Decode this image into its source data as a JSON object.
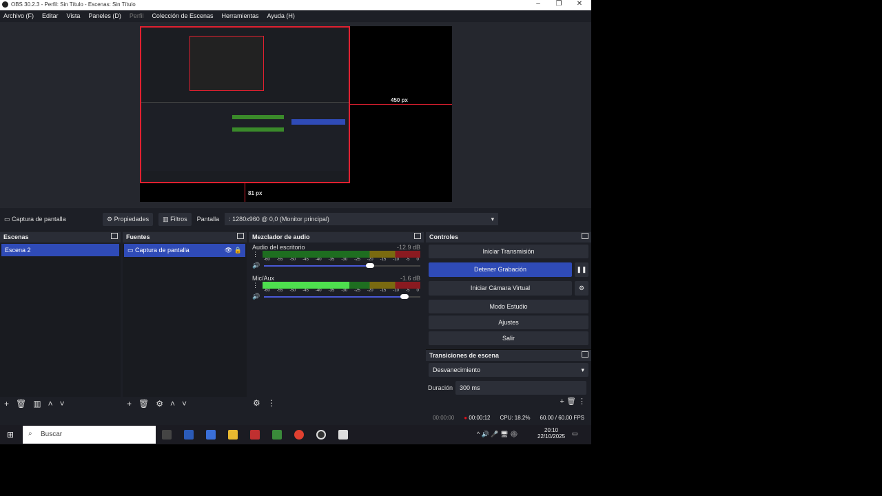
{
  "window": {
    "title": "OBS 30.2.3 - Perfil: Sin Título - Escenas: Sin Título"
  },
  "menu": [
    "Archivo (F)",
    "Editar",
    "Vista",
    "Paneles (D)",
    "Perfil",
    "Colección de Escenas",
    "Herramientas",
    "Ayuda (H)"
  ],
  "preview": {
    "right_label": "450 px",
    "bottom_label": "81 px"
  },
  "source_toolbar": {
    "source": "Captura de pantalla",
    "properties": "Propiedades",
    "filters": "Filtros",
    "display_label": "Pantalla",
    "display_value": ": 1280x960 @ 0,0 (Monitor principal)"
  },
  "scenes": {
    "title": "Escenas",
    "items": [
      "Escena 2"
    ]
  },
  "sources": {
    "title": "Fuentes",
    "items": [
      "Captura de pantalla"
    ]
  },
  "mixer": {
    "title": "Mezclador de audio",
    "ticks": [
      "-60",
      "-55",
      "-50",
      "-45",
      "-40",
      "-35",
      "-30",
      "-25",
      "-20",
      "-15",
      "-10",
      "-5",
      "0"
    ],
    "channels": [
      {
        "name": "Audio del escritorio",
        "db": "-12.9 dB",
        "level": 0,
        "volume": 0.68
      },
      {
        "name": "Mic/Aux",
        "db": "-1.6 dB",
        "level": 0.55,
        "volume": 0.9
      }
    ]
  },
  "controls": {
    "title": "Controles",
    "buttons": [
      "Iniciar Transmisión",
      "Detener Grabación",
      "Iniciar Cámara Virtual",
      "Modo Estudio",
      "Ajustes",
      "Salir"
    ]
  },
  "transitions": {
    "title": "Transiciones de escena",
    "type": "Desvanecimiento",
    "duration_label": "Duración",
    "duration": "300 ms"
  },
  "status": {
    "stream_time": "00:00:00",
    "rec_time": "00:00:12",
    "cpu": "CPU: 18.2%",
    "fps": "60.00 / 60.00 FPS"
  },
  "taskbar": {
    "search": "Buscar",
    "time": "20:10",
    "date": "22/10/2025"
  },
  "colors": {
    "accent": "#2f4bb7",
    "rec": "#e0101c",
    "bg": "#1d1f26"
  }
}
